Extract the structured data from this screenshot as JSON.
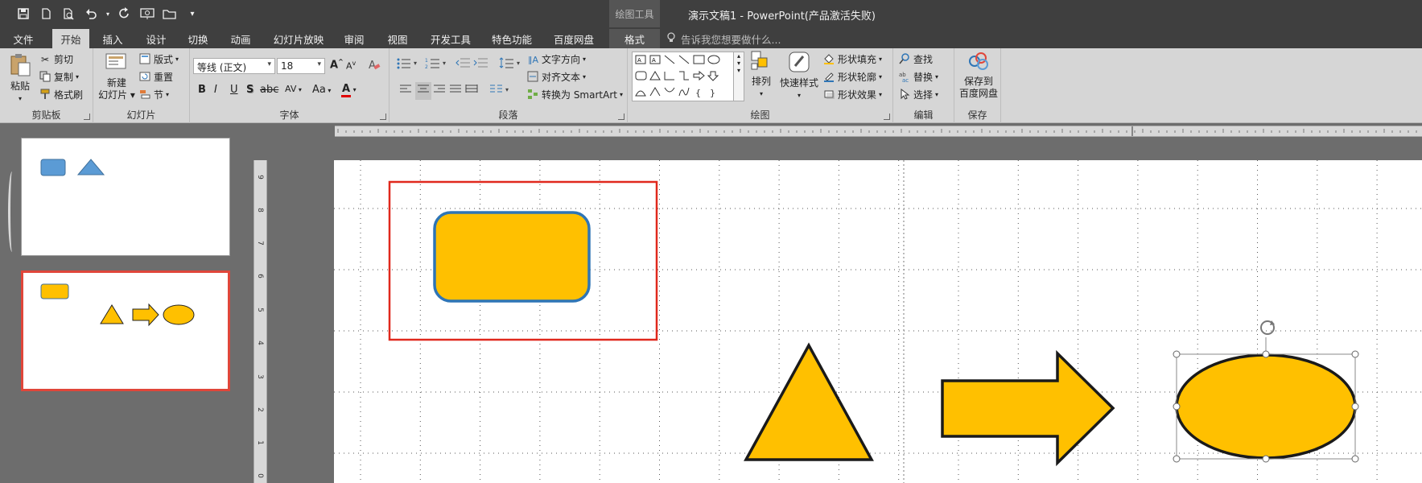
{
  "app": {
    "title": "演示文稿1 - PowerPoint(产品激活失败)",
    "context_tab": "绘图工具"
  },
  "qat": {
    "items": [
      "save-icon",
      "new-icon",
      "print-preview-icon",
      "undo-icon",
      "redo-icon",
      "slideshow-icon",
      "open-icon",
      "customize-icon"
    ]
  },
  "tabs": [
    {
      "label": "文件"
    },
    {
      "label": "开始"
    },
    {
      "label": "插入"
    },
    {
      "label": "设计"
    },
    {
      "label": "切换"
    },
    {
      "label": "动画"
    },
    {
      "label": "幻灯片放映"
    },
    {
      "label": "审阅"
    },
    {
      "label": "视图"
    },
    {
      "label": "开发工具"
    },
    {
      "label": "特色功能"
    },
    {
      "label": "百度网盘"
    },
    {
      "label": "格式"
    }
  ],
  "tellme": "告诉我您想要做什么...",
  "ribbon": {
    "clipboard": {
      "label": "剪贴板",
      "paste": "粘贴",
      "cut": "剪切",
      "copy": "复制",
      "format_painter": "格式刷"
    },
    "slides": {
      "label": "幻灯片",
      "new_slide_1": "新建",
      "new_slide_2": "幻灯片",
      "layout": "版式",
      "reset": "重置",
      "section": "节"
    },
    "font": {
      "label": "字体",
      "font_name": "等线 (正文)",
      "font_size": "18",
      "bold": "B",
      "italic": "I",
      "underline": "U",
      "shadow": "S",
      "spacing": "AV",
      "case": "Aa",
      "color": "A"
    },
    "paragraph": {
      "label": "段落",
      "text_direction": "文字方向",
      "align_text": "对齐文本",
      "smartart": "转换为 SmartArt"
    },
    "drawing": {
      "label": "绘图",
      "arrange": "排列",
      "quick_styles": "快速样式",
      "shape_fill": "形状填充",
      "shape_outline": "形状轮廓",
      "shape_effects": "形状效果"
    },
    "editing": {
      "label": "编辑",
      "find": "查找",
      "replace": "替换",
      "select": "选择"
    },
    "save": {
      "label": "保存",
      "save_to_1": "保存到",
      "save_to_2": "百度网盘"
    }
  },
  "ruler": {
    "vertical_numbers": [
      "9",
      "8",
      "7",
      "6",
      "5",
      "4",
      "3",
      "2",
      "1",
      "0"
    ]
  },
  "colors": {
    "shape_fill": "#ffc000",
    "shape_outline_dark": "#1a1a1a",
    "rounded_rect_outline": "#2e75b6",
    "selection_box": "#e0291d",
    "thumb_blue": "#5b9bd5",
    "active_thumb_border": "#e0463a"
  }
}
